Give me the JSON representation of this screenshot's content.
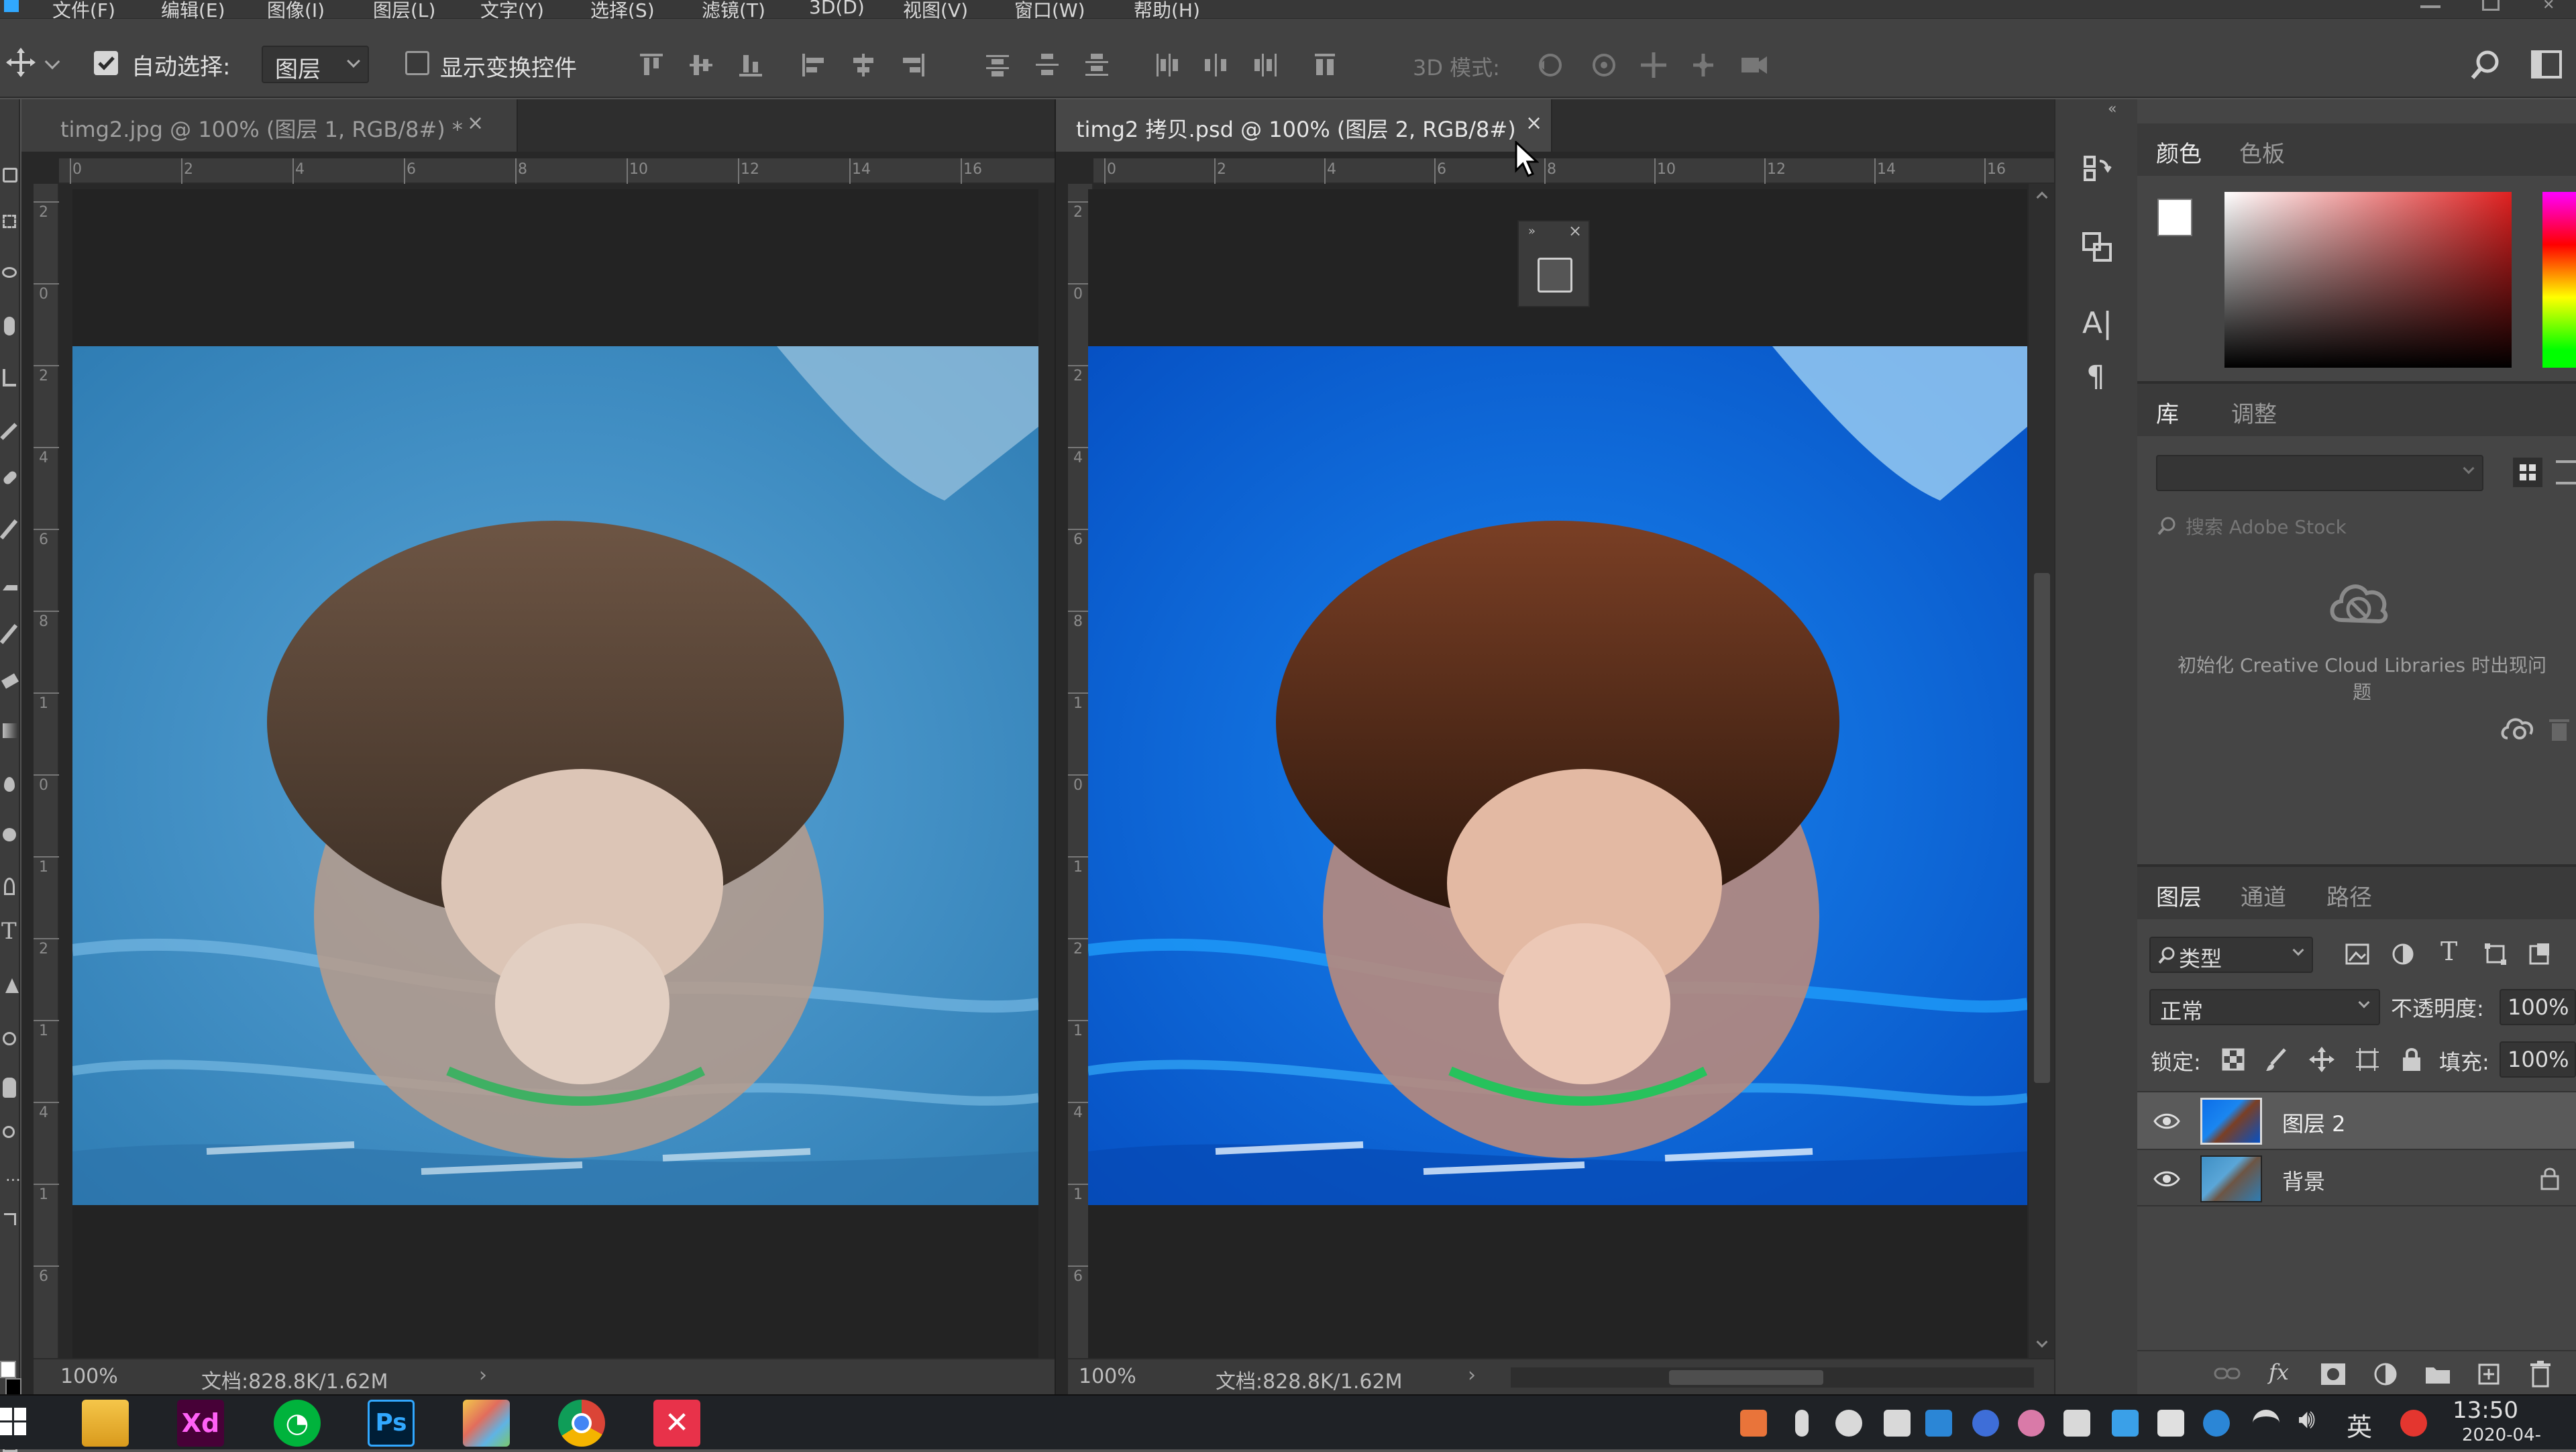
{
  "menu": [
    "文件(F)",
    "编辑(E)",
    "图像(I)",
    "图层(L)",
    "文字(Y)",
    "选择(S)",
    "滤镜(T)",
    "3D(D)",
    "视图(V)",
    "窗口(W)",
    "帮助(H)"
  ],
  "options_bar": {
    "auto_select_label": "自动选择:",
    "auto_select_checked": true,
    "auto_select_target": "图层",
    "show_transform_label": "显示变换控件",
    "show_transform_checked": false,
    "mode_3d_label": "3D 模式:"
  },
  "documents": [
    {
      "tab_title": "timg2.jpg @ 100% (图层 1, RGB/8#) *",
      "active": false,
      "ruler_top": [
        "0",
        "2",
        "4",
        "6",
        "8",
        "10",
        "12",
        "14",
        "16"
      ],
      "ruler_left": [
        "2",
        "0",
        "2",
        "4",
        "6",
        "8",
        "1",
        "0",
        "1",
        "2",
        "1",
        "4",
        "1",
        "6"
      ],
      "zoom": "100%",
      "doc_info": "文档:828.8K/1.62M"
    },
    {
      "tab_title": "timg2 拷贝.psd @ 100% (图层 2, RGB/8#)",
      "active": true,
      "ruler_top": [
        "0",
        "2",
        "4",
        "6",
        "8",
        "10",
        "12",
        "14",
        "16"
      ],
      "ruler_left": [
        "2",
        "0",
        "2",
        "4",
        "6",
        "8",
        "1",
        "0",
        "1",
        "2",
        "1",
        "4",
        "1",
        "6"
      ],
      "zoom": "100%",
      "doc_info": "文档:828.8K/1.62M"
    }
  ],
  "panels": {
    "color_tabs": [
      "颜色",
      "色板"
    ],
    "library_tabs": [
      "库",
      "调整"
    ],
    "library_search_placeholder": "搜索 Adobe Stock",
    "library_message": "初始化 Creative Cloud Libraries 时出现问题",
    "layers_tabs": [
      "图层",
      "通道",
      "路径"
    ],
    "filter_kind": "类型",
    "blend_mode": "正常",
    "opacity_label": "不透明度:",
    "opacity_value": "100%",
    "lock_label": "锁定:",
    "fill_label": "填充:",
    "fill_value": "100%",
    "layers": [
      {
        "name": "图层 2",
        "visible": true,
        "selected": true,
        "locked": false
      },
      {
        "name": "背景",
        "visible": true,
        "selected": false,
        "locked": true
      }
    ]
  },
  "taskbar": {
    "apps": [
      "windows-start",
      "file-explorer",
      "adobe-xd",
      "iqiyi",
      "photoshop",
      "paint",
      "chrome",
      "xmind"
    ],
    "ime_label": "英",
    "time": "13:50",
    "date": "2020-04-"
  },
  "colors": {
    "ps_blue": "#31a8ff",
    "pool_blue_original": "#3f8fc4",
    "pool_blue_edited": "#0d6ee8"
  }
}
